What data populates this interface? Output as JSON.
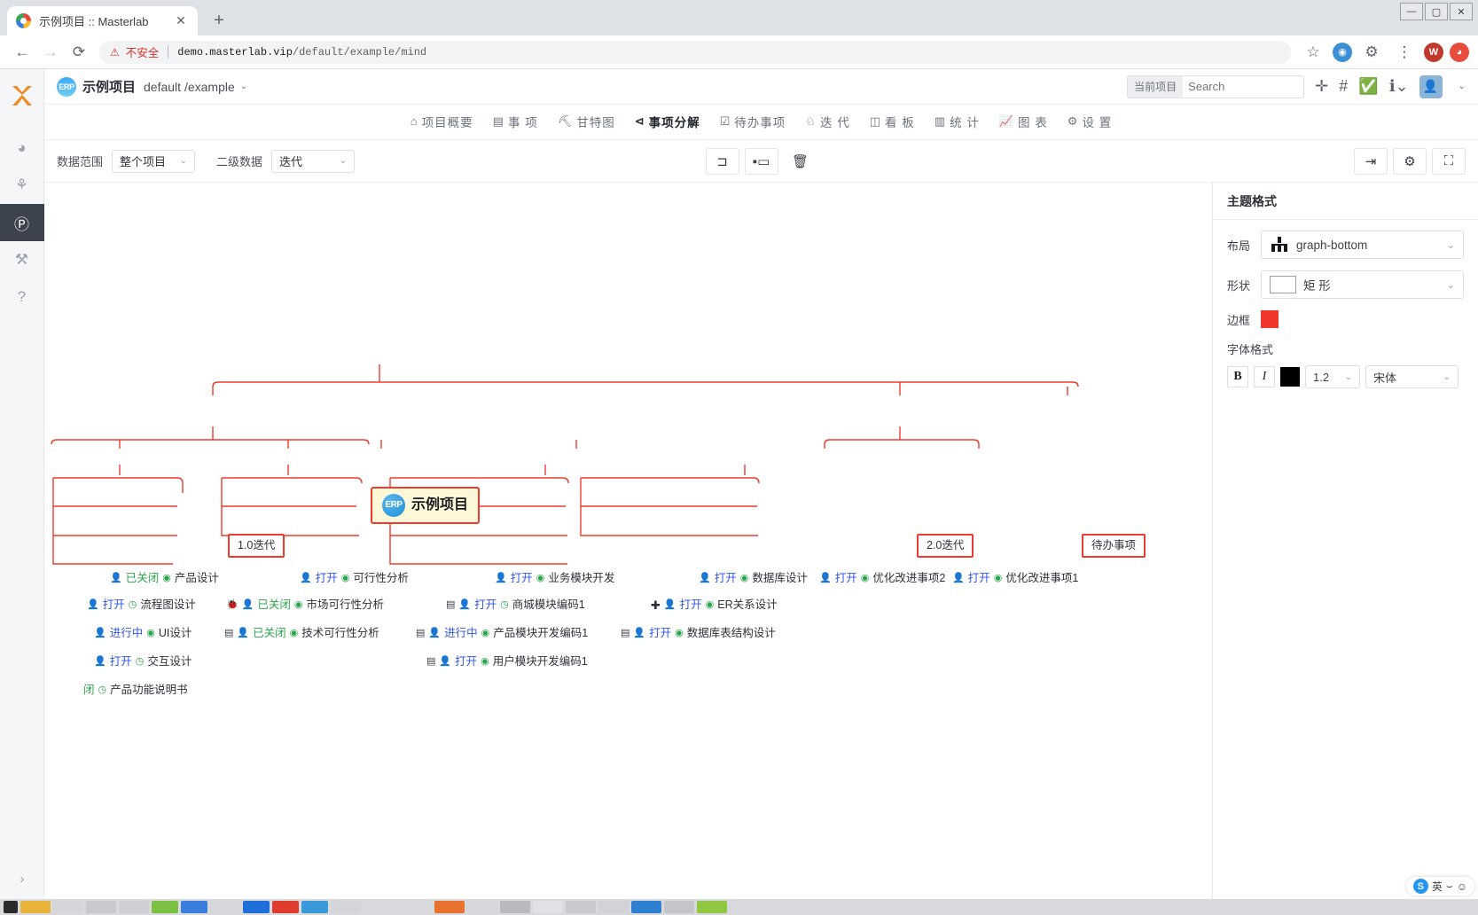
{
  "browser": {
    "tab_title": "示例项目 :: Masterlab",
    "tab_close": "✕",
    "new_tab": "+",
    "back": "←",
    "forward": "→",
    "reload": "⟳",
    "security_warning": "不安全",
    "url_domain": "demo.masterlab.vip",
    "url_path": "/default/example/mind",
    "star": "☆",
    "win_min": "—",
    "win_max": "▢",
    "win_close": "✕"
  },
  "header": {
    "project_badge": "ERP",
    "project_name": "示例项目",
    "project_path": "default /example",
    "caret": "⌄",
    "search_scope": "当前项目",
    "search_placeholder": "Search",
    "search_value": "",
    "icons": {
      "add": "✛",
      "hash": "#",
      "check": "✔",
      "info": "i",
      "avatar": "👤"
    }
  },
  "nav_tabs": [
    {
      "label": "项目概要",
      "icon": "⌂",
      "active": false
    },
    {
      "label": "事 项",
      "icon": "▤",
      "active": false
    },
    {
      "label": "甘特图",
      "icon": "⛏",
      "active": false
    },
    {
      "label": "事项分解",
      "icon": "⊲",
      "active": true
    },
    {
      "label": "待办事项",
      "icon": "☑",
      "active": false
    },
    {
      "label": "迭 代",
      "icon": "♘",
      "active": false
    },
    {
      "label": "看 板",
      "icon": "◫",
      "active": false
    },
    {
      "label": "统 计",
      "icon": "▥",
      "active": false
    },
    {
      "label": "图 表",
      "icon": "📈",
      "active": false
    },
    {
      "label": "设 置",
      "icon": "⚙",
      "active": false
    }
  ],
  "toolbar": {
    "scope_label": "数据范围",
    "scope_value": "整个项目",
    "second_label": "二级数据",
    "second_value": "迭代",
    "btn_collapse": "⊐",
    "btn_expand": "▪▭",
    "btn_delete": "🗑",
    "btn_export": "⇥",
    "btn_settings": "⚙",
    "btn_fullscreen": "⛶"
  },
  "panel": {
    "title": "主题格式",
    "layout_label": "布局",
    "layout_value": "graph-bottom",
    "shape_label": "形状",
    "shape_value": "矩 形",
    "border_label": "边框",
    "border_color": "#f0372b",
    "font_label": "字体格式",
    "bold": "B",
    "italic": "I",
    "font_color": "#000000",
    "font_size": "1.2",
    "font_family": "宋体",
    "caret": "⌄"
  },
  "mindmap": {
    "root": {
      "badge": "ERP",
      "label": "示例项目"
    },
    "iterations": [
      {
        "label": "1.0迭代"
      },
      {
        "label": "2.0迭代"
      },
      {
        "label": "待办事项"
      }
    ],
    "level2": [
      {
        "label": "产品设计",
        "status": "已关闭",
        "status_type": "closed",
        "person": "person",
        "play": "play"
      },
      {
        "label": "可行性分析",
        "status": "打开",
        "status_type": "open",
        "person": "person-red",
        "play": "play"
      },
      {
        "label": "业务模块开发",
        "status": "打开",
        "status_type": "open",
        "person": "person-red",
        "play": "play"
      },
      {
        "label": "数据库设计",
        "status": "打开",
        "status_type": "open",
        "person": "person",
        "play": "play"
      },
      {
        "label": "优化改进事项2",
        "status": "打开",
        "status_type": "open",
        "person": "person",
        "play": "play"
      },
      {
        "label": "优化改进事项1",
        "status": "打开",
        "status_type": "open",
        "person": "person",
        "play": "play"
      }
    ],
    "level3": [
      {
        "label": "流程图设计",
        "status": "打开",
        "status_type": "open",
        "lead": "",
        "play": "clock"
      },
      {
        "label": "UI设计",
        "status": "进行中",
        "status_type": "doing",
        "lead": "",
        "play": "play"
      },
      {
        "label": "交互设计",
        "status": "打开",
        "status_type": "open",
        "lead": "",
        "play": "clock"
      },
      {
        "label": "产品功能说明书",
        "status": "闭",
        "status_type": "closed",
        "lead": "",
        "play": "clock"
      },
      {
        "label": "市场可行性分析",
        "status": "已关闭",
        "status_type": "closed",
        "lead": "bug",
        "play": "play"
      },
      {
        "label": "技术可行性分析",
        "status": "已关闭",
        "status_type": "closed",
        "lead": "list",
        "play": "play"
      },
      {
        "label": "商城模块编码1",
        "status": "打开",
        "status_type": "open",
        "lead": "list",
        "play": "clock"
      },
      {
        "label": "产品模块开发编码1",
        "status": "进行中",
        "status_type": "doing",
        "lead": "list",
        "play": "play"
      },
      {
        "label": "用户模块开发编码1",
        "status": "打开",
        "status_type": "open",
        "lead": "list",
        "play": "play"
      },
      {
        "label": "ER关系设计",
        "status": "打开",
        "status_type": "open",
        "lead": "plus",
        "play": "play"
      },
      {
        "label": "数据库表结构设计",
        "status": "打开",
        "status_type": "open",
        "lead": "list",
        "play": "play"
      }
    ]
  },
  "sidebar": {
    "logo": "masterlab-logo",
    "items": [
      {
        "name": "dashboard",
        "icon": "◕"
      },
      {
        "name": "org",
        "icon": "⚘"
      },
      {
        "name": "project",
        "icon": "Ⓟ",
        "active": true
      },
      {
        "name": "tools",
        "icon": "⚒"
      },
      {
        "name": "help",
        "icon": "?"
      }
    ],
    "expand": "›"
  },
  "ime": {
    "label": "英",
    "dot": "S",
    "mark": "⌣",
    "face": "☺"
  }
}
